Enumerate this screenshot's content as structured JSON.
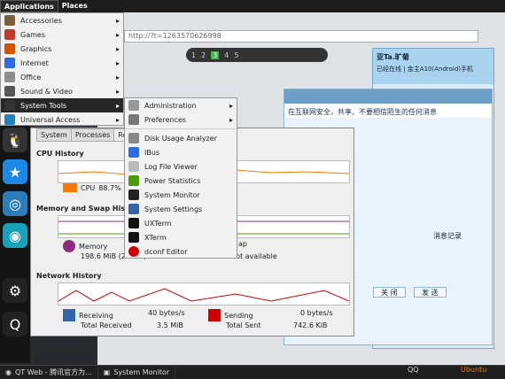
{
  "top_panel": {
    "applications": "Applications",
    "places": "Places"
  },
  "apps_menu": {
    "items": [
      {
        "label": "Accessories",
        "icon": "accessories-icon",
        "color": "#7b5f3a"
      },
      {
        "label": "Games",
        "icon": "games-icon",
        "color": "#c0392b"
      },
      {
        "label": "Graphics",
        "icon": "graphics-icon",
        "color": "#d35400"
      },
      {
        "label": "Internet",
        "icon": "internet-icon",
        "color": "#2d6cdf"
      },
      {
        "label": "Office",
        "icon": "office-icon",
        "color": "#8e8e8e"
      },
      {
        "label": "Sound & Video",
        "icon": "sound-video-icon",
        "color": "#555555"
      },
      {
        "label": "System Tools",
        "icon": "system-tools-icon",
        "color": "#333333"
      },
      {
        "label": "Universal Access",
        "icon": "universal-access-icon",
        "color": "#2980b9"
      }
    ]
  },
  "sub_menu": {
    "items": [
      {
        "label": "Administration",
        "icon": "administration-icon"
      },
      {
        "label": "Preferences",
        "icon": "preferences-icon"
      },
      {
        "label": "Disk Usage Analyzer",
        "icon": "disk-usage-icon"
      },
      {
        "label": "IBus",
        "icon": "ibus-icon"
      },
      {
        "label": "Log File Viewer",
        "icon": "log-viewer-icon"
      },
      {
        "label": "Power Statistics",
        "icon": "power-statistics-icon"
      },
      {
        "label": "System Monitor",
        "icon": "system-monitor-icon"
      },
      {
        "label": "System Settings",
        "icon": "system-settings-icon"
      },
      {
        "label": "UXTerm",
        "icon": "uxterm-icon"
      },
      {
        "label": "XTerm",
        "icon": "xterm-icon"
      },
      {
        "label": "dconf Editor",
        "icon": "dconf-editor-icon"
      }
    ]
  },
  "browser": {
    "url": "http://?t=1263570626998"
  },
  "workspace": {
    "numbers": [
      "1",
      "2",
      "3",
      "4",
      "5"
    ],
    "active": "3"
  },
  "system_monitor": {
    "tabs": [
      "System",
      "Processes",
      "Res"
    ],
    "cpu_history": "CPU History",
    "cpu_label": "CPU",
    "cpu_value": "88.7%",
    "mem_history": "Memory and Swap History",
    "memory_label": "Memory",
    "memory_value": "198.6 MiB (20.2%) of 983.0 MiB",
    "swap_label": "ap",
    "swap_value": "not available",
    "network_history": "Network History",
    "receiving_label": "Receiving",
    "receiving_value": "40 bytes/s",
    "total_received_label": "Total Received",
    "total_received_value": "3.5 MiB",
    "sending_label": "Sending",
    "sending_value": "0 bytes/s",
    "total_sent_label": "Total Sent",
    "total_sent_value": "742.6 KiB",
    "cpu_color": "#f57900"
  },
  "qq": {
    "contact_name": "亚Ta.旷菊",
    "status": "已经在线 | 金主A10(Android)手机",
    "notice": "在互联网安全，共享、不要相信陌生的任何消息",
    "close_btn": "关 闭",
    "send_btn": "发 送",
    "hist_btn": "消息记录"
  },
  "bottom_panel": {
    "tasks": [
      "QT Web - 腾讯官方为...",
      "System Monitor"
    ],
    "qq_label": "QQ",
    "ubuntu_label": "Ubuntu"
  }
}
